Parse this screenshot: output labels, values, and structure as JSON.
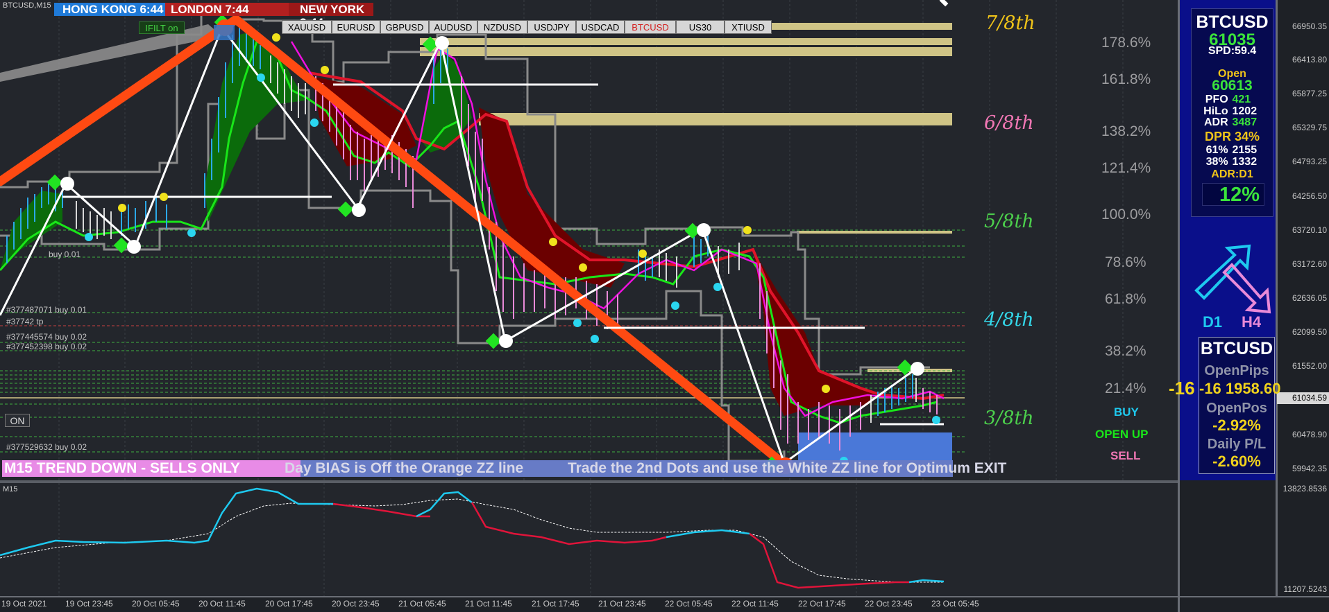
{
  "window": {
    "title": "BTCUSD,M15"
  },
  "sessions": [
    {
      "label": "HONG KONG",
      "time": "6:44",
      "bg": "#1f7ad8"
    },
    {
      "label": "LONDON",
      "time": "7:44",
      "bg": "#b22020"
    },
    {
      "label": "NEW YORK",
      "time": "2:44",
      "bg": "#9b1818"
    }
  ],
  "filter_badge": "IFILT on",
  "symbols": [
    "XAUUSD",
    "EURUSD",
    "GBPUSD",
    "AUDUSD",
    "NZDUSD",
    "USDJPY",
    "USDCAD",
    "BTCUSD",
    "US30",
    "XTIUSD"
  ],
  "active_symbol": "BTCUSD",
  "octaves": [
    {
      "label": "7/8th",
      "color": "#f0c419"
    },
    {
      "label": "6/8th",
      "color": "#f077b4"
    },
    {
      "label": "5/8th",
      "color": "#4ccf4c"
    },
    {
      "label": "4/8th",
      "color": "#34d6e8"
    },
    {
      "label": "3/8th",
      "color": "#4ccf4c"
    }
  ],
  "fib_levels": [
    "178.6%",
    "161.8%",
    "138.2%",
    "121.4%",
    "100.0%",
    "78.6%",
    "61.8%",
    "38.2%",
    "21.4%"
  ],
  "price_axis": [
    "66950.35",
    "66413.80",
    "65877.25",
    "65329.75",
    "64793.25",
    "64256.50",
    "63720.10",
    "63172.60",
    "62636.05",
    "62099.50",
    "61552.00",
    "61034.59",
    "60478.90",
    "59942.35"
  ],
  "indicator_axis": [
    "13823.8536",
    "11207.5243"
  ],
  "time_axis": [
    "19 Oct 2021",
    "19 Oct 23:45",
    "20 Oct 05:45",
    "20 Oct 11:45",
    "20 Oct 17:45",
    "20 Oct 23:45",
    "21 Oct 05:45",
    "21 Oct 11:45",
    "21 Oct 17:45",
    "21 Oct 23:45",
    "22 Oct 05:45",
    "22 Oct 11:45",
    "22 Oct 17:45",
    "22 Oct 23:45",
    "23 Oct 05:45"
  ],
  "orders": [
    "#377487071 buy 0.01",
    "#37742 tp",
    "#377445574 buy 0.02",
    "#377452398 buy 0.02",
    "#377529632 buy 0.02",
    "buy 0.01"
  ],
  "on_button": "ON",
  "right_tags": {
    "buy": "BUY",
    "open_up": "OPEN UP",
    "sell": "SELL",
    "price": "-16 1958.60"
  },
  "panel1": {
    "symbol": "BTCUSD",
    "price": "61035",
    "spd": "SPD:59.4",
    "open_label": "Open",
    "open_value": "60613",
    "rows": [
      {
        "k": "PFO",
        "v": "421"
      },
      {
        "k": "HiLo",
        "v": "1202"
      },
      {
        "k": "ADR",
        "v": "3487"
      }
    ],
    "dpr": "DPR 34%",
    "r61": {
      "k": "61%",
      "v": "2155"
    },
    "r38": {
      "k": "38%",
      "v": "1332"
    },
    "adr_tf": "ADR:D1",
    "pct": "12%"
  },
  "arrows": {
    "d1": "D1",
    "h4": "H4"
  },
  "panel2": {
    "symbol": "BTCUSD",
    "open_pips_label": "OpenPips",
    "open_pips": "-16 1958.60",
    "open_pos_label": "OpenPos",
    "open_pos": "-2.92%",
    "daily_label": "Daily P/L",
    "daily": "-2.60%"
  },
  "banner": {
    "trend": "M15  TREND DOWN - SELLS ONLY",
    "bias": "Day BIAS is Off the Orange ZZ line",
    "trade": "Trade the 2nd Dots and use the White ZZ line for Optimum EXIT"
  },
  "indicator_title": "M15",
  "colors": {
    "bg": "#1e2126",
    "orange_zz": "#ff4a12",
    "white_zz": "#ffffff",
    "bull_fill": "#0b6b0b",
    "bear_fill": "#6b0000",
    "band": "#8b8b8b",
    "gold_zone": "#cfc486"
  }
}
